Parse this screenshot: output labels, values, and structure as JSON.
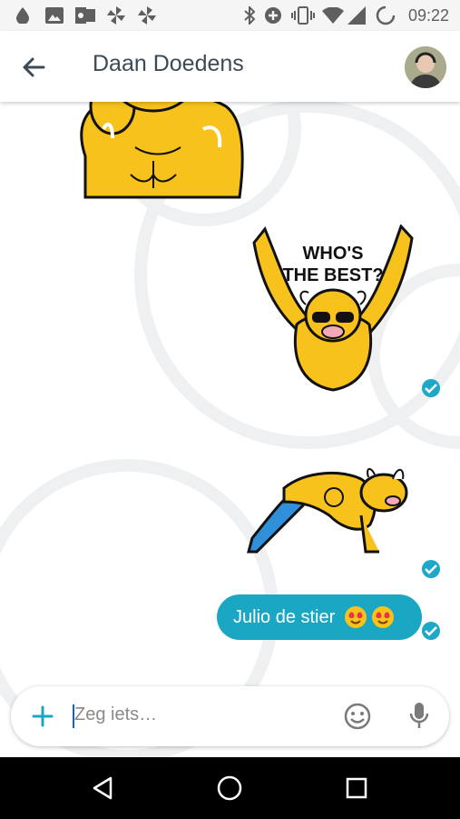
{
  "status_bar": {
    "time": "09:22",
    "icons": [
      "drop-icon",
      "image-icon",
      "outlook-icon",
      "pinwheel-icon",
      "pinwheel-icon",
      "bluetooth-icon",
      "data-saver-icon",
      "vibrate-icon",
      "wifi-icon",
      "signal-icon",
      "sync-icon"
    ]
  },
  "header": {
    "title": "Daan Doedens",
    "back_icon": "arrow-left-icon",
    "avatar_icon": "user-avatar"
  },
  "messages": [
    {
      "type": "sticker",
      "sender": "contact",
      "description": "bull-flexing-sticker"
    },
    {
      "type": "sticker",
      "sender": "me",
      "caption": "WHO'S THE BEST?",
      "read": true
    },
    {
      "type": "sticker",
      "sender": "me",
      "description": "bull-pushup-sticker",
      "read": true
    },
    {
      "type": "text",
      "sender": "me",
      "text": "Julio de stier",
      "emoji": [
        "heart-eyes-emoji",
        "heart-eyes-emoji"
      ],
      "read": true
    }
  ],
  "composer": {
    "placeholder": "Zeg iets…",
    "add_icon": "plus-icon",
    "emoji_icon": "smiley-icon",
    "mic_icon": "microphone-icon"
  },
  "nav_bar": {
    "buttons": [
      "back-triangle-icon",
      "home-circle-icon",
      "recents-square-icon"
    ]
  },
  "colors": {
    "accent": "#1aa7c4",
    "sticker_yellow": "#f7c21b",
    "title_text": "#3c4a55"
  }
}
